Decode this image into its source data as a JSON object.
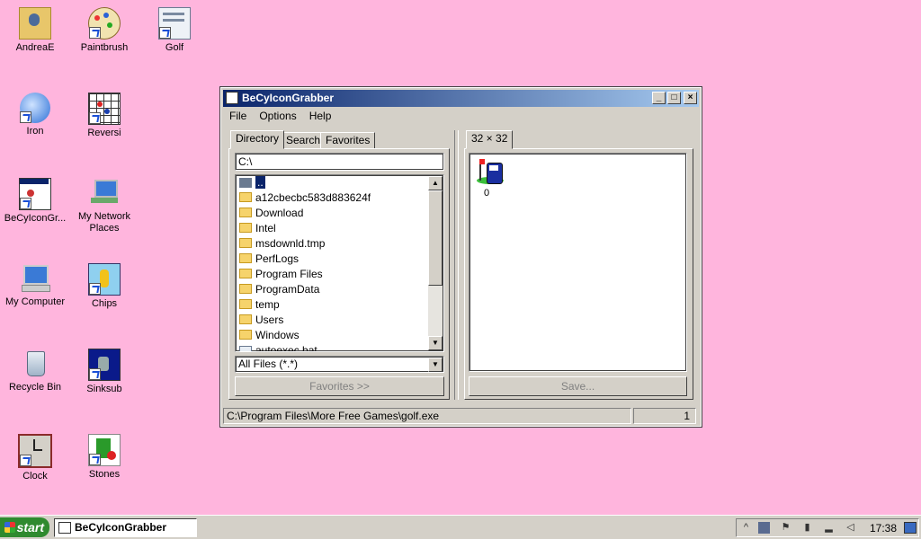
{
  "desktop": {
    "icons": [
      {
        "label": "AndreaE",
        "icon": "user-folder-icon"
      },
      {
        "label": "Paintbrush",
        "icon": "paint-palette-icon"
      },
      {
        "label": "Golf",
        "icon": "golf-app-icon"
      },
      {
        "label": "Iron",
        "icon": "iron-golf-icon"
      },
      {
        "label": "Reversi",
        "icon": "reversi-board-icon"
      },
      {
        "label": "BeCyIconGr...",
        "icon": "icon-grabber-icon"
      },
      {
        "label": "My Network Places",
        "icon": "network-places-icon"
      },
      {
        "label": "My Computer",
        "icon": "computer-icon"
      },
      {
        "label": "Chips",
        "icon": "chips-game-icon"
      },
      {
        "label": "Recycle Bin",
        "icon": "recycle-bin-icon"
      },
      {
        "label": "Sinksub",
        "icon": "sinksub-icon"
      },
      {
        "label": "Clock",
        "icon": "clock-icon"
      },
      {
        "label": "Stones",
        "icon": "stones-game-icon"
      }
    ]
  },
  "window": {
    "title": "BeCyIconGrabber",
    "menu": [
      "File",
      "Options",
      "Help"
    ],
    "left_tabs": [
      "Directory",
      "Search",
      "Favorites"
    ],
    "path_value": "C:\\",
    "parent_entry": "..",
    "files": [
      "a12cbecbc583d883624f",
      "Download",
      "Intel",
      "msdownld.tmp",
      "PerfLogs",
      "Program Files",
      "ProgramData",
      "temp",
      "Users",
      "Windows",
      "autoexec.bat"
    ],
    "filter_value": "All Files (*.*)",
    "favorites_button": "Favorites >>",
    "right_tab": "32 × 32",
    "icon_index": "0",
    "save_button": "Save...",
    "status_path": "C:\\Program Files\\More Free Games\\golf.exe",
    "status_count": "1"
  },
  "taskbar": {
    "start_label": "start",
    "task_label": "BeCyIconGrabber",
    "clock": "17:38"
  }
}
